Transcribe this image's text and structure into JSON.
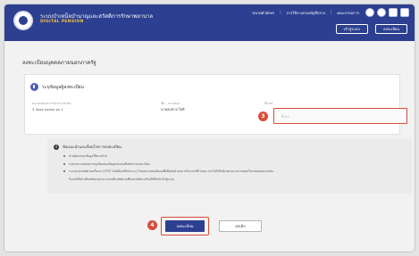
{
  "header": {
    "brand_name": "ระบบบำเหน็จบำนาญและสวัสดิการรักษาพยาบาล",
    "brand_sub": "DIGITAL PENSION",
    "top_links": [
      "ขนาดตัวอักษร",
      "การใช้งานกรมบัญชีกลาง",
      "คณะกรรมการ"
    ],
    "buttons": [
      "เข้าสู่ระบบ",
      "ลงทะเบียน"
    ]
  },
  "page": {
    "title": "ลงทะเบียนบุคคลภายนอกภาครัฐ"
  },
  "card": {
    "title": "ระบุข้อมูลผู้ลงทะเบียน",
    "fields": [
      {
        "label": "หมายเลขประจำตัวประชาชน",
        "value": "3 3xxx xxxxx xx 1"
      },
      {
        "label": "ชื่อ - นามสกุล",
        "value": "นายสมชาย ใจดี"
      },
      {
        "label": "อีเมล*",
        "placeholder": "อีเมล"
      }
    ]
  },
  "notice": {
    "title": "ข้อแนะนำและเงื่อนไขการลงทะเบียน",
    "items": [
      "ท่านต้องกรอกข้อมูลให้ครบถ้วน",
      "กรุณาตรวจสอบความถูกต้องของข้อมูลก่อนกดยืนยันการลงทะเบียน",
      "ระบบจะส่งรหัสผ่านครั้งแรก (OTP) ไปยังอีเมลที่ท่านระบุ โปรดตรวจสอบอีเมลเพื่อยืนยันตัวตนภายในเวลาที่กำหนด หากไม่ได้รับอีเมลกรุณาตรวจสอบในกล่องจดหมายขยะ",
      "ในกรณีที่ท่านลืมรหัสผ่านสามารถกดลืมรหัสผ่านเพื่อขอรหัสผ่านใหม่ได้ที่หน้าเข้าสู่ระบบ"
    ]
  },
  "actions": {
    "submit": "ลงทะเบียน",
    "cancel": "ยกเลิก"
  },
  "markers": {
    "email": "3",
    "submit": "4"
  }
}
